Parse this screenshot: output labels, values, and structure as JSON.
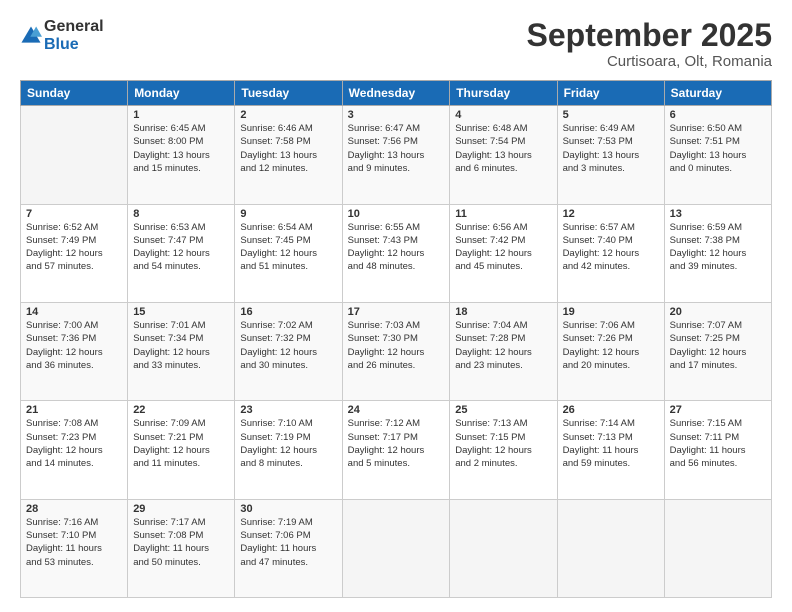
{
  "logo": {
    "general": "General",
    "blue": "Blue"
  },
  "title": "September 2025",
  "location": "Curtisoara, Olt, Romania",
  "weekdays": [
    "Sunday",
    "Monday",
    "Tuesday",
    "Wednesday",
    "Thursday",
    "Friday",
    "Saturday"
  ],
  "weeks": [
    [
      {
        "day": "",
        "info": ""
      },
      {
        "day": "1",
        "info": "Sunrise: 6:45 AM\nSunset: 8:00 PM\nDaylight: 13 hours\nand 15 minutes."
      },
      {
        "day": "2",
        "info": "Sunrise: 6:46 AM\nSunset: 7:58 PM\nDaylight: 13 hours\nand 12 minutes."
      },
      {
        "day": "3",
        "info": "Sunrise: 6:47 AM\nSunset: 7:56 PM\nDaylight: 13 hours\nand 9 minutes."
      },
      {
        "day": "4",
        "info": "Sunrise: 6:48 AM\nSunset: 7:54 PM\nDaylight: 13 hours\nand 6 minutes."
      },
      {
        "day": "5",
        "info": "Sunrise: 6:49 AM\nSunset: 7:53 PM\nDaylight: 13 hours\nand 3 minutes."
      },
      {
        "day": "6",
        "info": "Sunrise: 6:50 AM\nSunset: 7:51 PM\nDaylight: 13 hours\nand 0 minutes."
      }
    ],
    [
      {
        "day": "7",
        "info": "Sunrise: 6:52 AM\nSunset: 7:49 PM\nDaylight: 12 hours\nand 57 minutes."
      },
      {
        "day": "8",
        "info": "Sunrise: 6:53 AM\nSunset: 7:47 PM\nDaylight: 12 hours\nand 54 minutes."
      },
      {
        "day": "9",
        "info": "Sunrise: 6:54 AM\nSunset: 7:45 PM\nDaylight: 12 hours\nand 51 minutes."
      },
      {
        "day": "10",
        "info": "Sunrise: 6:55 AM\nSunset: 7:43 PM\nDaylight: 12 hours\nand 48 minutes."
      },
      {
        "day": "11",
        "info": "Sunrise: 6:56 AM\nSunset: 7:42 PM\nDaylight: 12 hours\nand 45 minutes."
      },
      {
        "day": "12",
        "info": "Sunrise: 6:57 AM\nSunset: 7:40 PM\nDaylight: 12 hours\nand 42 minutes."
      },
      {
        "day": "13",
        "info": "Sunrise: 6:59 AM\nSunset: 7:38 PM\nDaylight: 12 hours\nand 39 minutes."
      }
    ],
    [
      {
        "day": "14",
        "info": "Sunrise: 7:00 AM\nSunset: 7:36 PM\nDaylight: 12 hours\nand 36 minutes."
      },
      {
        "day": "15",
        "info": "Sunrise: 7:01 AM\nSunset: 7:34 PM\nDaylight: 12 hours\nand 33 minutes."
      },
      {
        "day": "16",
        "info": "Sunrise: 7:02 AM\nSunset: 7:32 PM\nDaylight: 12 hours\nand 30 minutes."
      },
      {
        "day": "17",
        "info": "Sunrise: 7:03 AM\nSunset: 7:30 PM\nDaylight: 12 hours\nand 26 minutes."
      },
      {
        "day": "18",
        "info": "Sunrise: 7:04 AM\nSunset: 7:28 PM\nDaylight: 12 hours\nand 23 minutes."
      },
      {
        "day": "19",
        "info": "Sunrise: 7:06 AM\nSunset: 7:26 PM\nDaylight: 12 hours\nand 20 minutes."
      },
      {
        "day": "20",
        "info": "Sunrise: 7:07 AM\nSunset: 7:25 PM\nDaylight: 12 hours\nand 17 minutes."
      }
    ],
    [
      {
        "day": "21",
        "info": "Sunrise: 7:08 AM\nSunset: 7:23 PM\nDaylight: 12 hours\nand 14 minutes."
      },
      {
        "day": "22",
        "info": "Sunrise: 7:09 AM\nSunset: 7:21 PM\nDaylight: 12 hours\nand 11 minutes."
      },
      {
        "day": "23",
        "info": "Sunrise: 7:10 AM\nSunset: 7:19 PM\nDaylight: 12 hours\nand 8 minutes."
      },
      {
        "day": "24",
        "info": "Sunrise: 7:12 AM\nSunset: 7:17 PM\nDaylight: 12 hours\nand 5 minutes."
      },
      {
        "day": "25",
        "info": "Sunrise: 7:13 AM\nSunset: 7:15 PM\nDaylight: 12 hours\nand 2 minutes."
      },
      {
        "day": "26",
        "info": "Sunrise: 7:14 AM\nSunset: 7:13 PM\nDaylight: 11 hours\nand 59 minutes."
      },
      {
        "day": "27",
        "info": "Sunrise: 7:15 AM\nSunset: 7:11 PM\nDaylight: 11 hours\nand 56 minutes."
      }
    ],
    [
      {
        "day": "28",
        "info": "Sunrise: 7:16 AM\nSunset: 7:10 PM\nDaylight: 11 hours\nand 53 minutes."
      },
      {
        "day": "29",
        "info": "Sunrise: 7:17 AM\nSunset: 7:08 PM\nDaylight: 11 hours\nand 50 minutes."
      },
      {
        "day": "30",
        "info": "Sunrise: 7:19 AM\nSunset: 7:06 PM\nDaylight: 11 hours\nand 47 minutes."
      },
      {
        "day": "",
        "info": ""
      },
      {
        "day": "",
        "info": ""
      },
      {
        "day": "",
        "info": ""
      },
      {
        "day": "",
        "info": ""
      }
    ]
  ]
}
